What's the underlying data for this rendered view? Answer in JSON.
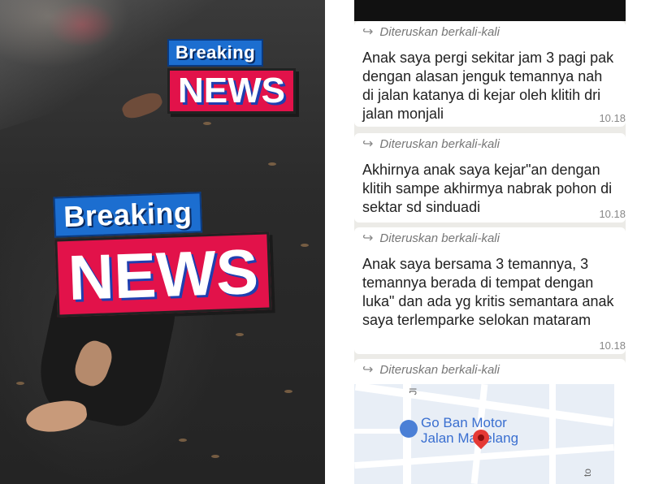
{
  "photo": {
    "badge_top": {
      "line1": "Breaking",
      "line2": "NEWS"
    },
    "badge_bottom": {
      "line1": "Breaking",
      "line2": "NEWS"
    }
  },
  "chat": {
    "messages": [
      {
        "forward_label": "Diteruskan berkali-kali",
        "text": "Anak saya pergi sekitar jam 3 pagi pak dengan alasan jenguk temannya nah di jalan katanya di kejar oleh klitih dri jalan monjali",
        "time": "10.18"
      },
      {
        "forward_label": "Diteruskan berkali-kali",
        "text": "Akhirnya anak saya kejar\"an dengan klitih sampe akhirmya nabrak pohon di sektar sd sinduadi",
        "time": "10.18"
      },
      {
        "forward_label": "Diteruskan berkali-kali",
        "text": "Anak saya bersama 3 temannya, 3 temannya berada di tempat dengan luka\" dan ada yg kritis semantara anak saya terlemparke selokan mataram",
        "time": "10.18"
      },
      {
        "forward_label": "Diteruskan berkali-kali"
      }
    ],
    "map": {
      "place_label_line1": "Go Ban Motor",
      "place_label_line2": "Jalan Magelang",
      "street_jl": "Jl",
      "street_to": "to"
    }
  }
}
